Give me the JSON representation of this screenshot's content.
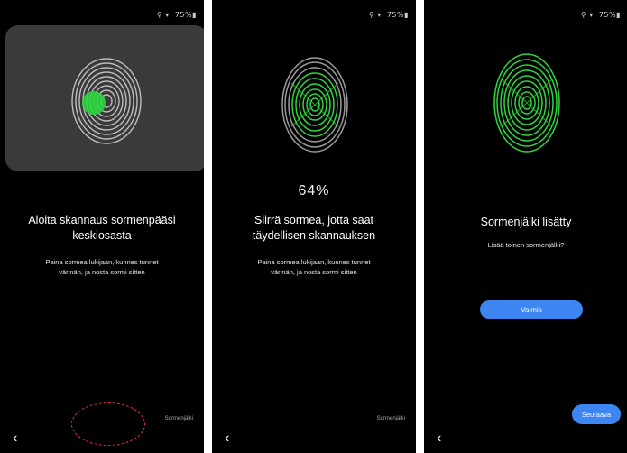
{
  "status_bar": {
    "icons": "⚲ ▾",
    "text": "75%▮"
  },
  "colors": {
    "background": "#000000",
    "panel": "#3a3a3a",
    "accent_blue": "#3d86f2",
    "fingerprint_green": "#2ed63e",
    "fingerprint_gray": "#bdbdbd",
    "sensor_ring": "#e0312f"
  },
  "screen1": {
    "title_line1": "Aloita skannaus sormenpääsi",
    "title_line2": "keskiosasta",
    "sub_line1": "Paina sormea lukijaan, kunnes tunnet",
    "sub_line2": "värinän, ja nosta sormi sitten",
    "brand": "Sormenjälki",
    "back_icon": "back-arrow-icon",
    "scan_progress": 0.15
  },
  "screen2": {
    "percent": "64%",
    "title_line1": "Siirrä sormea, jotta saat",
    "title_line2": "täydellisen skannauksen",
    "sub_line1": "Paina sormea lukijaan, kunnes tunnet",
    "sub_line2": "värinän, ja nosta sormi sitten",
    "brand": "Sormenjälki",
    "back_icon": "back-arrow-icon",
    "scan_progress": 0.64
  },
  "screen3": {
    "title": "Sormenjälki lisätty",
    "sub": "Lisää toinen sormenjälki?",
    "ok_label": "Valmis",
    "add_label": "Seuraava",
    "back_icon": "back-arrow-icon",
    "scan_progress": 1.0
  }
}
